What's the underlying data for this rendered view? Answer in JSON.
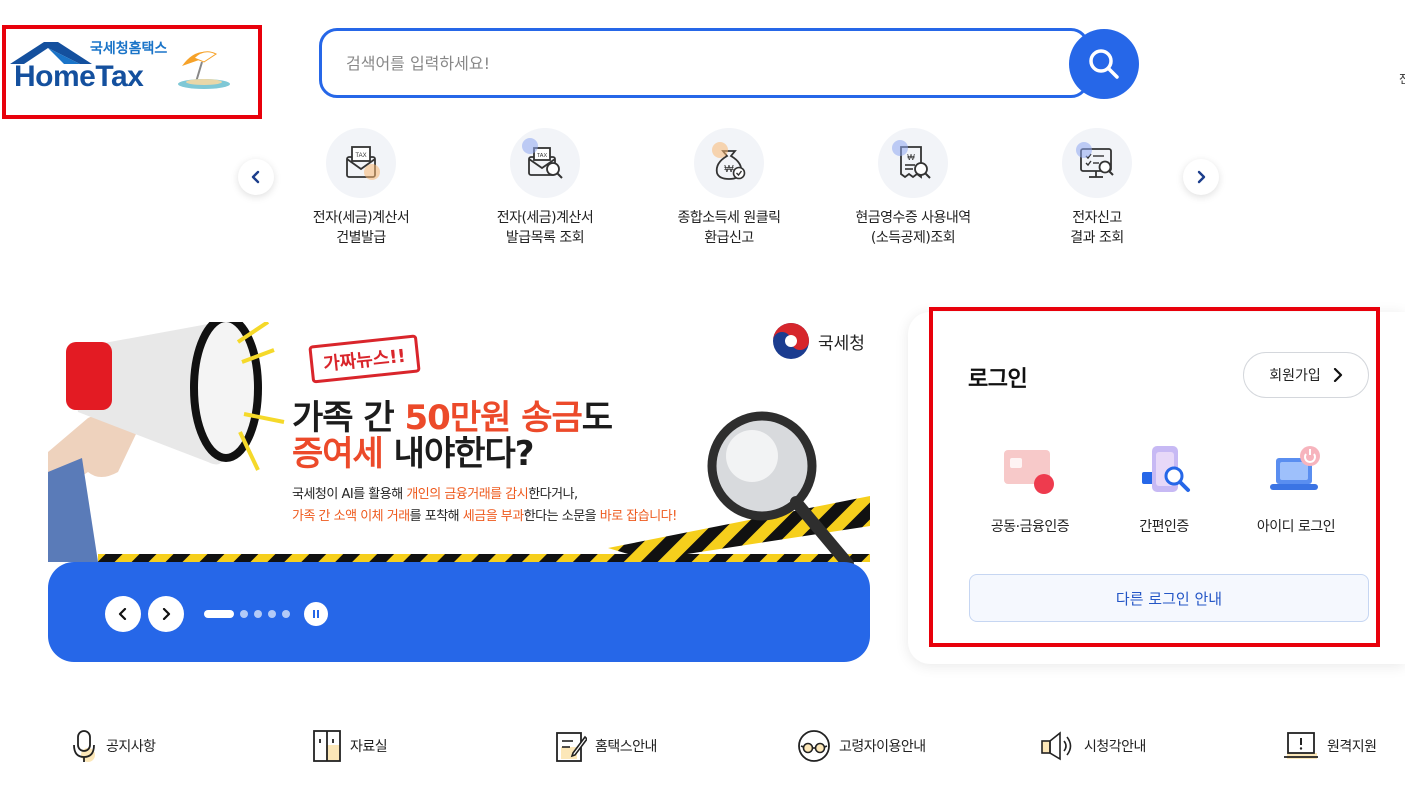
{
  "header": {
    "logo_kr": "국세청홈택스",
    "logo_en": "HomeTax",
    "search_placeholder": "검색어를 입력하세요!",
    "edge_char": "전"
  },
  "quick_menu": {
    "items": [
      {
        "label": "전자(세금)계산서\n건별발급",
        "icon": "tax-envelope-icon"
      },
      {
        "label": "전자(세금)계산서\n발급목록 조회",
        "icon": "tax-search-icon"
      },
      {
        "label": "종합소득세 원클릭\n환급신고",
        "icon": "money-bag-icon"
      },
      {
        "label": "현금영수증 사용내역\n(소득공제)조회",
        "icon": "receipt-search-icon"
      },
      {
        "label": "전자신고\n결과 조회",
        "icon": "monitor-check-icon"
      }
    ]
  },
  "banner": {
    "agency": "국세청",
    "stamp": "가짜뉴스!!",
    "headline1_a": "가족 간 ",
    "headline1_b": "50만원 송금",
    "headline1_c": "도",
    "headline2_a": "증여세",
    "headline2_b": " 내야한다?",
    "desc1_a": "국세청이 AI를 활용해 ",
    "desc1_b": "개인의 금융거래를 감시",
    "desc1_c": "한다거나,",
    "desc2_a": "가족 간 소액 이체 거래",
    "desc2_b": "를 포착해 ",
    "desc2_c": "세금을 부과",
    "desc2_d": "한다는 소문을 ",
    "desc2_e": "바로 잡습니다!",
    "slide_count": 5,
    "active_slide": 1
  },
  "login": {
    "title": "로그인",
    "signup_label": "회원가입",
    "options": [
      {
        "label": "공동·금융인증",
        "icon": "certificate-card-icon"
      },
      {
        "label": "간편인증",
        "icon": "phone-search-icon"
      },
      {
        "label": "아이디 로그인",
        "icon": "laptop-power-icon"
      }
    ],
    "other_login_label": "다른 로그인 안내"
  },
  "bottom_nav": [
    {
      "label": "공지사항",
      "icon": "microphone-icon"
    },
    {
      "label": "자료실",
      "icon": "cabinet-icon"
    },
    {
      "label": "홈택스안내",
      "icon": "document-pen-icon"
    },
    {
      "label": "고령자이용안내",
      "icon": "glasses-icon"
    },
    {
      "label": "시청각안내",
      "icon": "speaker-icon"
    },
    {
      "label": "원격지원",
      "icon": "laptop-alert-icon"
    }
  ],
  "colors": {
    "primary_blue": "#2667e8",
    "highlight_red": "#e8000b",
    "accent_orange": "#ec4a2a"
  }
}
